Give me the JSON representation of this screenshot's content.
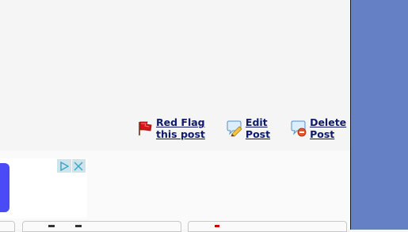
{
  "post_actions": {
    "red_flag": {
      "line1": "Red Flag",
      "line2": "this post",
      "icon": "red-flag-icon"
    },
    "edit": {
      "line1": "Edit",
      "line2": "Post",
      "icon": "edit-pencil-icon"
    },
    "delete": {
      "line1": "Delete",
      "line2": "Post",
      "icon": "delete-bubble-icon"
    }
  },
  "ad": {
    "adchoices_icon": "adchoices-icon",
    "close_icon": "close-icon"
  },
  "colors": {
    "link": "#0f1a6b",
    "right_panel": "#6680c6",
    "ad_accent": "#4a4af7",
    "ad_control_bg": "#cfe3ea"
  }
}
